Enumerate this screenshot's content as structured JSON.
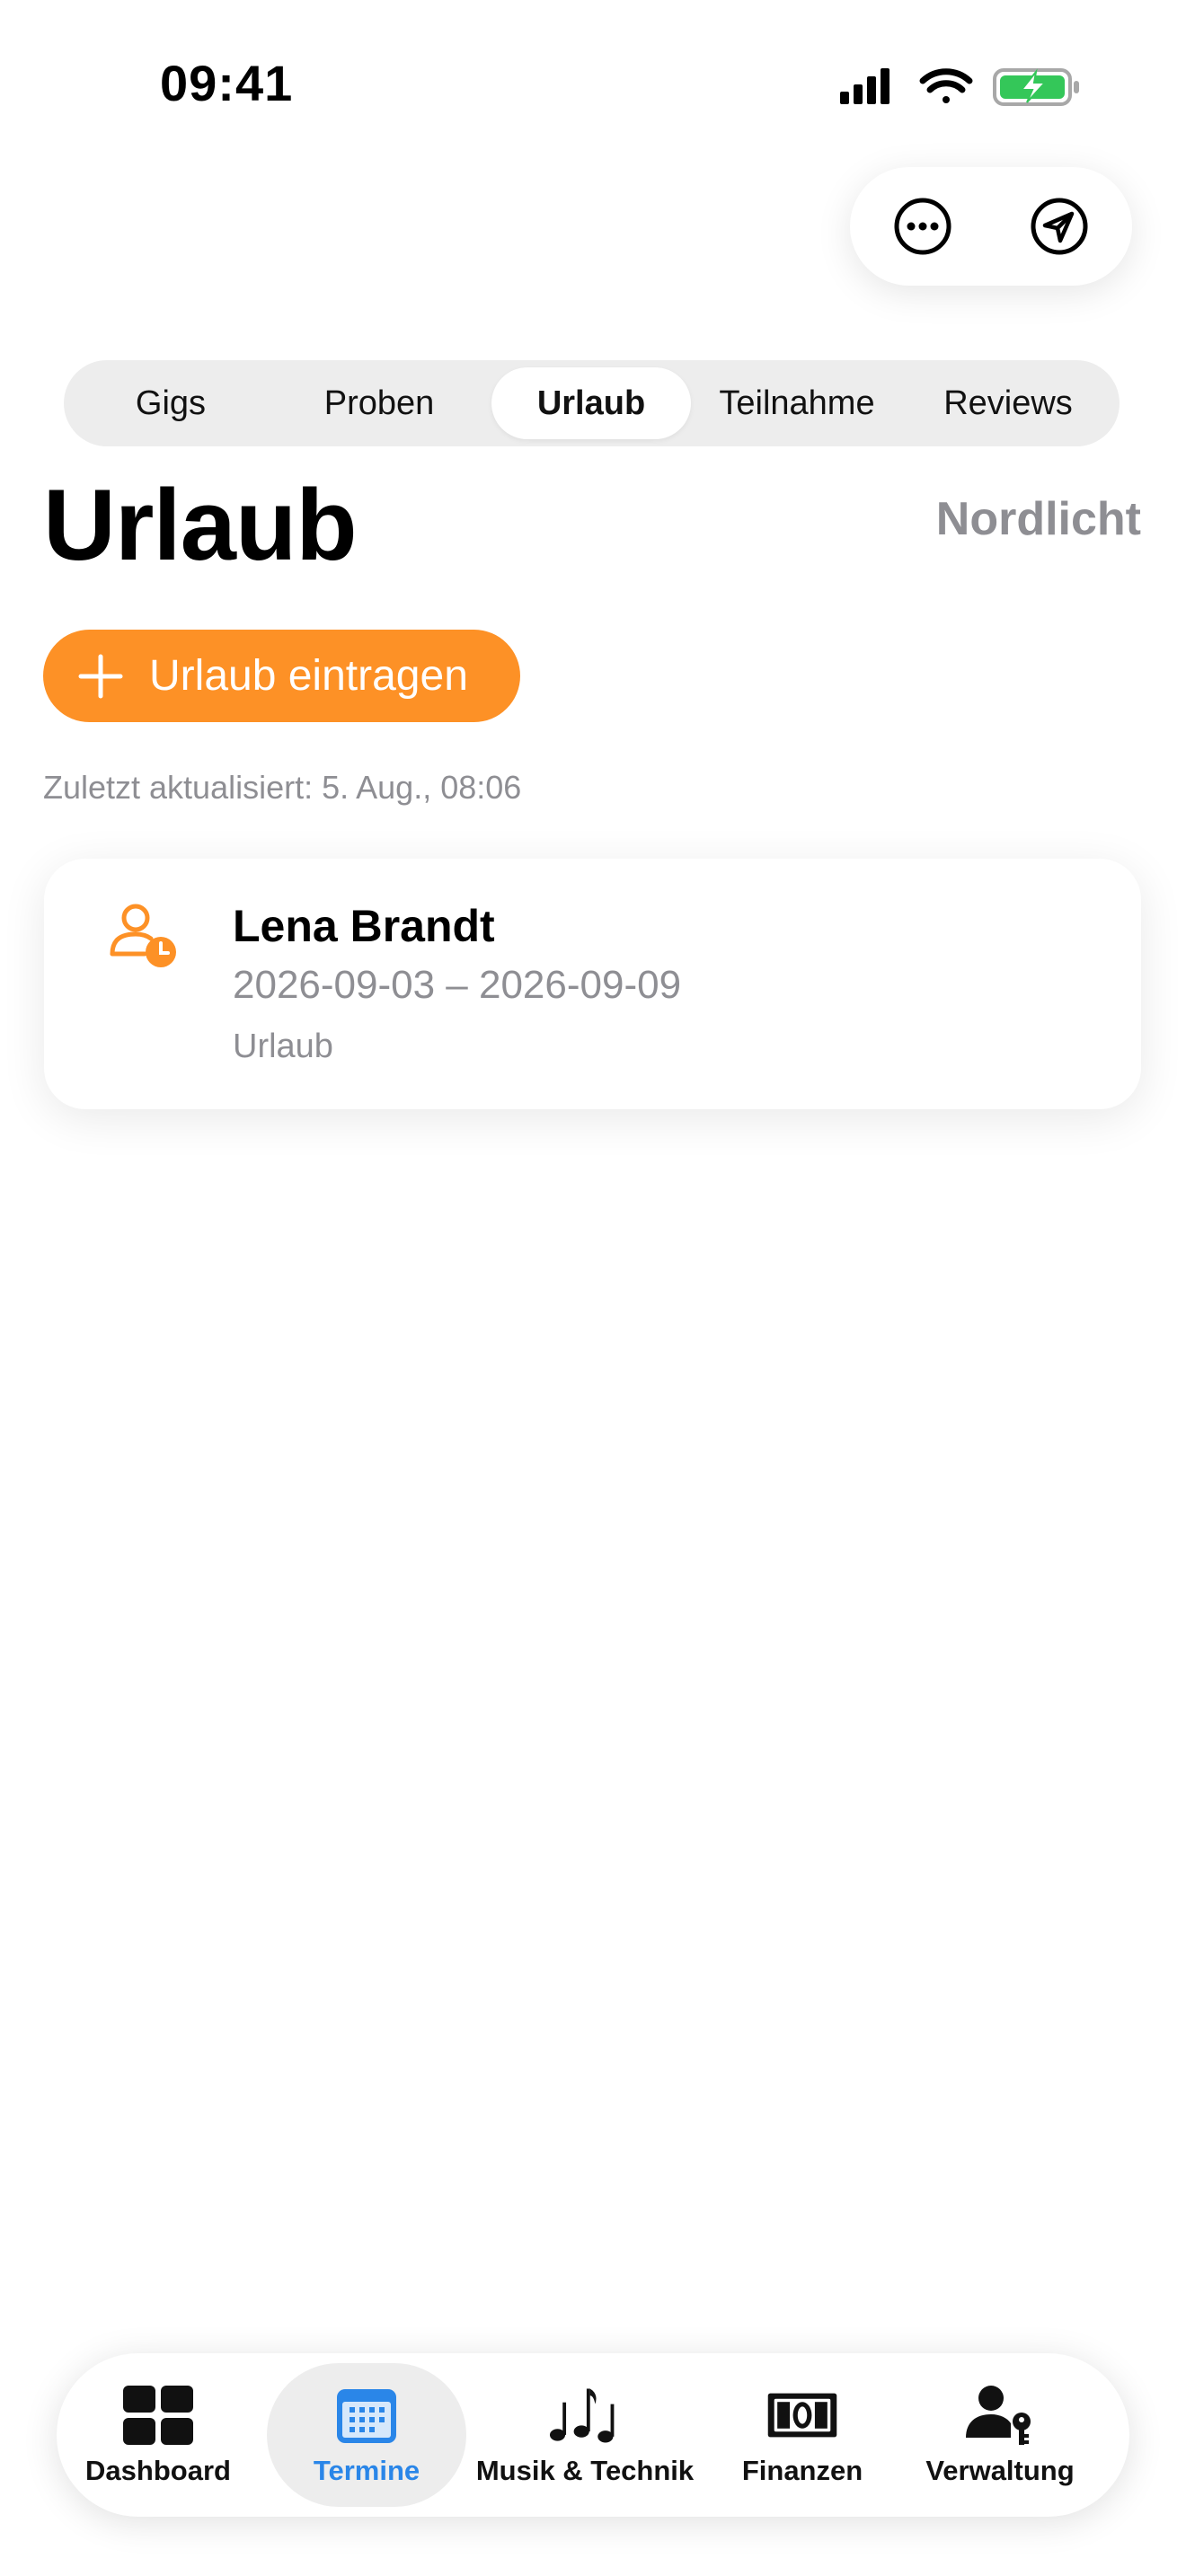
{
  "status_bar": {
    "time": "09:41"
  },
  "top_actions": {
    "more_icon": "ellipsis-circle-icon",
    "location_icon": "location-arrow-icon"
  },
  "segments": [
    {
      "label": "Gigs",
      "active": false
    },
    {
      "label": "Proben",
      "active": false
    },
    {
      "label": "Urlaub",
      "active": true
    },
    {
      "label": "Teilnahme",
      "active": false
    },
    {
      "label": "Reviews",
      "active": false
    }
  ],
  "header": {
    "title": "Urlaub",
    "band": "Nordlicht"
  },
  "add_button": {
    "label": "Urlaub eintragen",
    "color": "#fd9126"
  },
  "updated": "Zuletzt aktualisiert: 5. Aug., 08:06",
  "entries": [
    {
      "name": "Lena Brandt",
      "dates": "2026-09-03 – 2026-09-09",
      "type": "Urlaub",
      "icon": "person-clock-icon"
    }
  ],
  "tabbar": {
    "accent": "#2a86e8",
    "tabs": [
      {
        "label": "Dashboard",
        "icon": "dashboard-grid-icon",
        "active": false
      },
      {
        "label": "Termine",
        "icon": "calendar-icon",
        "active": true
      },
      {
        "label": "Musik & Technik",
        "icon": "music-notes-icon",
        "active": false
      },
      {
        "label": "Finanzen",
        "icon": "banknote-icon",
        "active": false
      },
      {
        "label": "Verwaltung",
        "icon": "person-key-icon",
        "active": false
      }
    ]
  }
}
